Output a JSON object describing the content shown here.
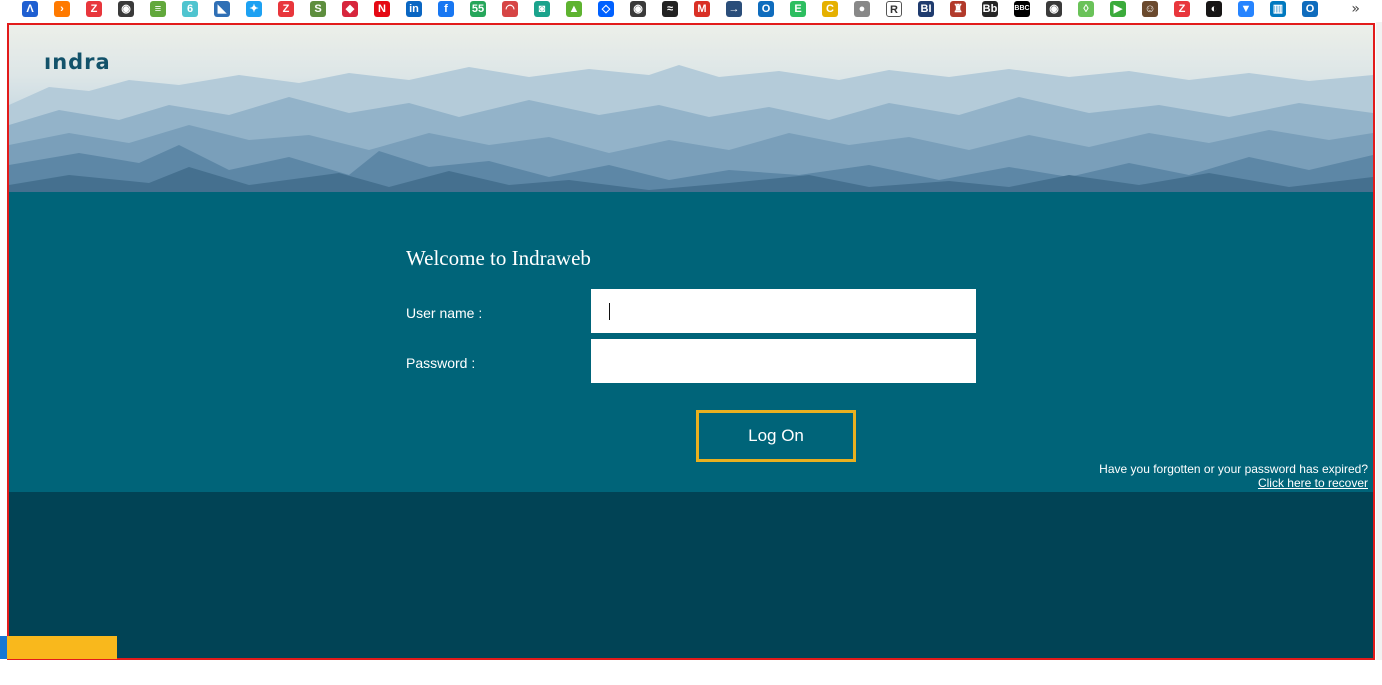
{
  "bookmarks": {
    "items": [
      {
        "name": "atlassian-icon",
        "color": "#1f5fd1",
        "glyph": "Λ"
      },
      {
        "name": "chevron-app-icon",
        "color": "#ff7a00",
        "glyph": "›"
      },
      {
        "name": "zoho-icon",
        "color": "#e8363c",
        "glyph": "Z"
      },
      {
        "name": "globe-icon",
        "color": "#3a3a3a",
        "glyph": "◉"
      },
      {
        "name": "site-badge-icon",
        "color": "#62a83c",
        "glyph": "≡"
      },
      {
        "name": "swirl-icon",
        "color": "#4fc4cf",
        "glyph": "6"
      },
      {
        "name": "shark-icon",
        "color": "#2f6fb5",
        "glyph": "◣"
      },
      {
        "name": "twitter-icon",
        "color": "#1da1f2",
        "glyph": "✦"
      },
      {
        "name": "zoho-icon-2",
        "color": "#e8363c",
        "glyph": "Z"
      },
      {
        "name": "shopify-icon",
        "color": "#5e8e3e",
        "glyph": "S"
      },
      {
        "name": "diamond-icon",
        "color": "#d7263d",
        "glyph": "◆"
      },
      {
        "name": "netflix-icon",
        "color": "#e50914",
        "glyph": "N"
      },
      {
        "name": "linkedin-icon",
        "color": "#0a66c2",
        "glyph": "in"
      },
      {
        "name": "facebook-icon",
        "color": "#1877f2",
        "glyph": "f"
      },
      {
        "name": "green-badge-icon",
        "color": "#26a65b",
        "glyph": "55"
      },
      {
        "name": "gauge-icon",
        "color": "#d64545",
        "glyph": "◠"
      },
      {
        "name": "bot-icon",
        "color": "#1aa38c",
        "glyph": "◙"
      },
      {
        "name": "triangle-icon",
        "color": "#5eb330",
        "glyph": "▲"
      },
      {
        "name": "dropbox-icon",
        "color": "#0061ff",
        "glyph": "◇"
      },
      {
        "name": "globe-icon-2",
        "color": "#3a3a3a",
        "glyph": "◉"
      },
      {
        "name": "road-icon",
        "color": "#222222",
        "glyph": "≈"
      },
      {
        "name": "gmail-icon",
        "color": "#d93025",
        "glyph": "M"
      },
      {
        "name": "arrow-circle-icon",
        "color": "#2b4e7a",
        "glyph": "→"
      },
      {
        "name": "outlook-icon",
        "color": "#0f6cbd",
        "glyph": "O"
      },
      {
        "name": "evernote-icon",
        "color": "#2dbe60",
        "glyph": "E"
      },
      {
        "name": "c-logo-icon",
        "color": "#e5b000",
        "glyph": "C"
      },
      {
        "name": "apple-icon",
        "color": "#888888",
        "glyph": "●"
      },
      {
        "name": "r-logo-icon",
        "color": "#ffffff",
        "glyph": "R"
      },
      {
        "name": "bi-logo-icon",
        "color": "#1f3b6e",
        "glyph": "BI"
      },
      {
        "name": "shield-crest-icon",
        "color": "#b23a2b",
        "glyph": "♜"
      },
      {
        "name": "blackboard-icon",
        "color": "#262626",
        "glyph": "Bb"
      },
      {
        "name": "bbc-icon",
        "color": "#000000",
        "glyph": "BBC"
      },
      {
        "name": "globe-icon-3",
        "color": "#3a3a3a",
        "glyph": "◉"
      },
      {
        "name": "green-diamond-icon",
        "color": "#6ac259",
        "glyph": "◊"
      },
      {
        "name": "play-icon",
        "color": "#3bab3b",
        "glyph": "▶"
      },
      {
        "name": "avatar-icon",
        "color": "#6b4a2e",
        "glyph": "☺"
      },
      {
        "name": "zoho-icon-3",
        "color": "#e8363c",
        "glyph": "Z"
      },
      {
        "name": "github-icon",
        "color": "#171515",
        "glyph": "◐"
      },
      {
        "name": "bitbucket-icon",
        "color": "#2684ff",
        "glyph": "▼"
      },
      {
        "name": "trello-icon",
        "color": "#0079bf",
        "glyph": "▥"
      },
      {
        "name": "outlook-icon-2",
        "color": "#0f6cbd",
        "glyph": "O"
      }
    ],
    "more": "»"
  },
  "logo": {
    "text": "ındra",
    "color": "#12526a"
  },
  "login": {
    "welcome": "Welcome to Indraweb",
    "username_label": "User name :",
    "username_value": "",
    "password_label": "Password :",
    "password_value": "",
    "logon_label": "Log On",
    "forgot_text": "Have you forgotten or your password has expired?",
    "recover_link": "Click here to recover"
  },
  "colors": {
    "panel": "#006479",
    "footer": "#014355",
    "button_border": "#e9b01f",
    "frame_border": "#e21b1b",
    "taskbar_accent": "#f9b81c"
  }
}
